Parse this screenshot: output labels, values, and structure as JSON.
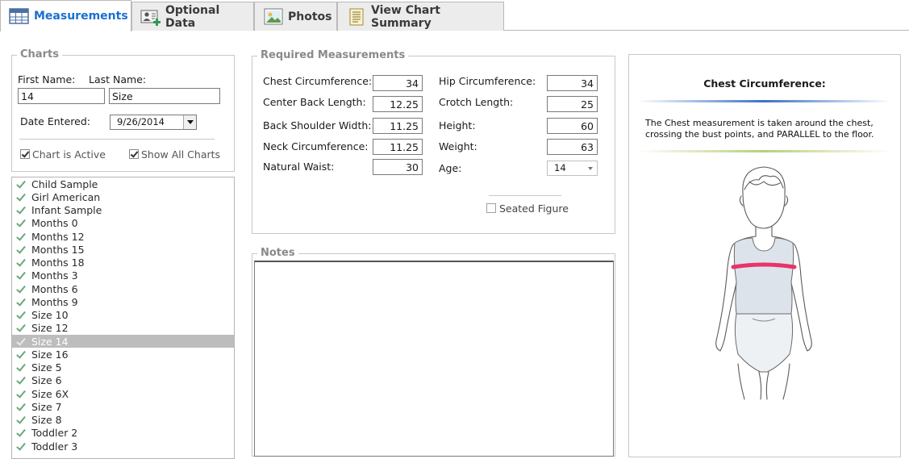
{
  "tabs": [
    {
      "label": "Measurements",
      "icon": "table-grid-icon",
      "active": true
    },
    {
      "label": "Optional Data",
      "icon": "add-person-icon",
      "active": false
    },
    {
      "label": "Photos",
      "icon": "photo-icon",
      "active": false
    },
    {
      "label": "View Chart Summary",
      "icon": "document-icon",
      "active": false
    }
  ],
  "charts": {
    "title": "Charts",
    "first_name_label": "First Name:",
    "last_name_label": "Last Name:",
    "first_name_value": "14",
    "last_name_value": "Size",
    "date_label": "Date Entered:",
    "date_value": "9/26/2014",
    "active_label": "Chart is Active",
    "active_checked": true,
    "show_all_label": "Show All Charts",
    "show_all_checked": true,
    "list": [
      "Child Sample",
      "Girl American",
      "Infant Sample",
      "Months 0",
      "Months 12",
      "Months 15",
      "Months 18",
      "Months 3",
      "Months 6",
      "Months 9",
      "Size 10",
      "Size 12",
      "Size 14",
      "Size 16",
      "Size 5",
      "Size 6",
      "Size 6X",
      "Size 7",
      "Size 8",
      "Toddler 2",
      "Toddler 3"
    ],
    "selected": "Size 14"
  },
  "measurements": {
    "title": "Required Measurements",
    "left": [
      {
        "label": "Chest Circumference:",
        "value": "34"
      },
      {
        "label": "Center Back Length:",
        "value": "12.25"
      },
      {
        "label": "Back Shoulder Width:",
        "value": "11.25"
      },
      {
        "label": "Neck Circumference:",
        "value": "11.25"
      },
      {
        "label": "Natural Waist:",
        "value": "30"
      }
    ],
    "right": [
      {
        "label": "Hip Circumference:",
        "value": "34"
      },
      {
        "label": "Crotch Length:",
        "value": "25"
      },
      {
        "label": "Height:",
        "value": "60"
      },
      {
        "label": "Weight:",
        "value": "63"
      }
    ],
    "age_label": "Age:",
    "age_value": "14",
    "seated_label": "Seated Figure",
    "seated_checked": false
  },
  "notes": {
    "title": "Notes",
    "value": ""
  },
  "info": {
    "title": "Chest Circumference:",
    "description": "The Chest measurement is taken around the chest, crossing the bust points, and PARALLEL to the floor.",
    "figure_icon": "child-figure-icon",
    "highlight_color": "#e8336b"
  }
}
